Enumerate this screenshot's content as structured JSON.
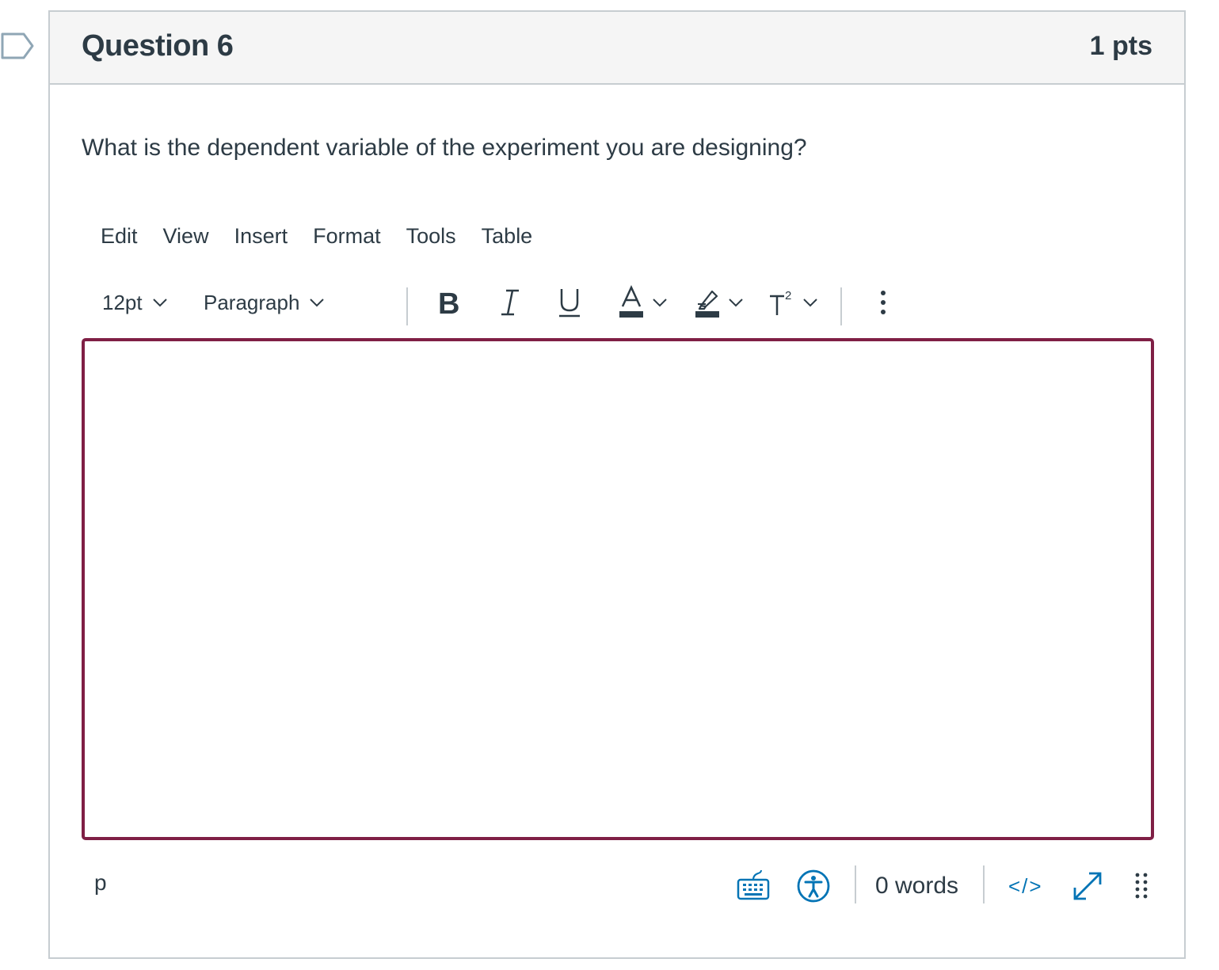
{
  "question": {
    "title": "Question 6",
    "points": "1 pts",
    "text": "What is the dependent variable of the experiment you are designing?",
    "flag_icon": "bookmark-flag-icon"
  },
  "editor": {
    "menu": [
      "Edit",
      "View",
      "Insert",
      "Format",
      "Tools",
      "Table"
    ],
    "toolbar": {
      "font_size": "12pt",
      "block_format": "Paragraph",
      "bold_icon": "bold-icon",
      "italic_icon": "italic-icon",
      "underline_icon": "underline-icon",
      "text_color_icon": "text-color-icon",
      "highlight_icon": "highlight-color-icon",
      "superscript_icon": "superscript-icon",
      "more_icon": "more-vertical-icon"
    },
    "content": "",
    "status": {
      "path": "p",
      "word_count": "0 words",
      "keyboard_icon": "keyboard-shortcuts-icon",
      "accessibility_icon": "accessibility-checker-icon",
      "html_toggle": "</>",
      "fullscreen_icon": "fullscreen-icon",
      "resize_icon": "resize-handle-icon"
    },
    "colors": {
      "focus_border": "#7f1f45",
      "accent_blue": "#0374b5",
      "text": "#2d3b45",
      "border": "#c7cdd1"
    }
  }
}
